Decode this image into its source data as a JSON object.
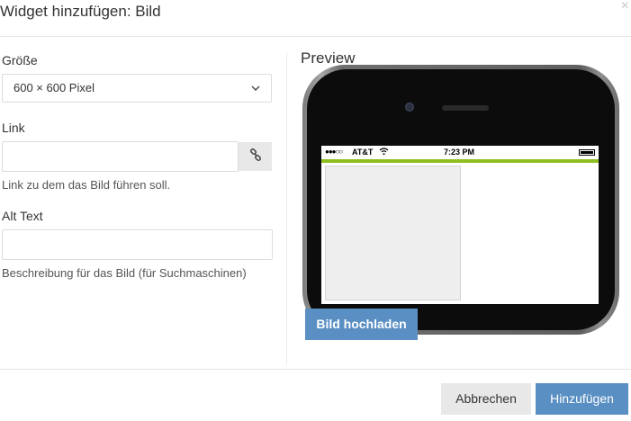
{
  "dialog": {
    "title": "Widget hinzufügen: Bild",
    "close_symbol": "×"
  },
  "form": {
    "size_label": "Größe",
    "size_value": "600 × 600 Pixel",
    "link_label": "Link",
    "link_value": "",
    "link_help": "Link zu dem das Bild führen soll.",
    "alt_label": "Alt Text",
    "alt_value": "",
    "alt_help": "Beschreibung für das Bild (für Suchmaschinen)"
  },
  "preview": {
    "label": "Preview",
    "status_bar": {
      "signal": "●●●○○",
      "carrier": "AT&T",
      "time": "7:23 PM"
    },
    "accent_color": "#8fbe1f",
    "upload_label": "Bild hochladen"
  },
  "footer": {
    "cancel_label": "Abbrechen",
    "submit_label": "Hinzufügen"
  },
  "colors": {
    "primary": "#5a8fc3",
    "secondary_button": "#e8e8e8"
  },
  "icons": {
    "size_dropdown": "chevron-down-icon",
    "link_button": "chain-link-icon",
    "wifi": "wifi-icon",
    "battery": "battery-icon",
    "close": "close-icon"
  }
}
